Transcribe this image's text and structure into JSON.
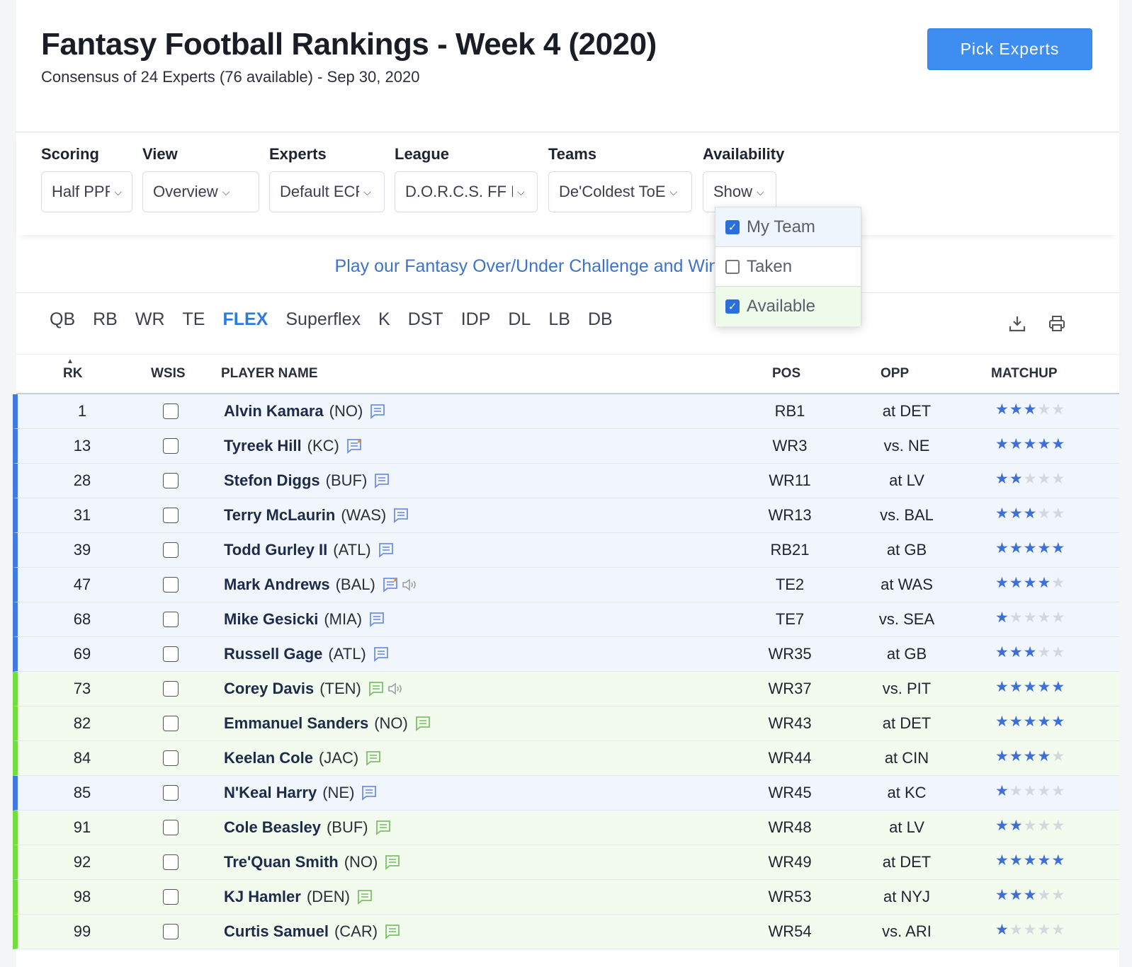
{
  "header": {
    "title": "Fantasy Football Rankings - Week 4 (2020)",
    "subtitle": "Consensus of 24 Experts (76 available) - Sep 30, 2020",
    "pick_experts_label": "Pick Experts"
  },
  "filters": {
    "scoring": {
      "label": "Scoring",
      "value": "Half PPR"
    },
    "view": {
      "label": "View",
      "value": "Overview"
    },
    "experts": {
      "label": "Experts",
      "value": "Default ECR"
    },
    "league": {
      "label": "League",
      "value": "D.O.R.C.S. FF League"
    },
    "teams": {
      "label": "Teams",
      "value": "De'Coldest ToE"
    },
    "availability": {
      "label": "Availability",
      "value": "Show"
    }
  },
  "availability_dropdown": {
    "items": [
      {
        "label": "My Team",
        "checked": true
      },
      {
        "label": "Taken",
        "checked": false
      },
      {
        "label": "Available",
        "checked": true
      }
    ]
  },
  "promo": "Play our Fantasy Over/Under Challenge and Win",
  "position_tabs": [
    "QB",
    "RB",
    "WR",
    "TE",
    "FLEX",
    "Superflex",
    "K",
    "DST",
    "IDP",
    "DL",
    "LB",
    "DB"
  ],
  "active_tab": "FLEX",
  "icons": {
    "download": "download-icon",
    "print": "print-icon",
    "note": "note-icon",
    "sound": "sound-icon"
  },
  "colors": {
    "my_team": "#3f7be0",
    "available": "#72dd3c",
    "accent": "#3d8ef0",
    "star": "#3e6fd8"
  },
  "table": {
    "headers": {
      "rk": "RK",
      "wsis": "WSIS",
      "player": "PLAYER NAME",
      "pos": "POS",
      "opp": "OPP",
      "matchup": "MATCHUP"
    },
    "rows": [
      {
        "rk": "1",
        "name": "Alvin Kamara",
        "team": "(NO)",
        "pos": "RB1",
        "opp": "at DET",
        "stars": 3,
        "status": "my_team",
        "note": "plain",
        "sound": false
      },
      {
        "rk": "13",
        "name": "Tyreek Hill",
        "team": "(KC)",
        "pos": "WR3",
        "opp": "vs. NE",
        "stars": 5,
        "status": "my_team",
        "note": "new",
        "sound": false
      },
      {
        "rk": "28",
        "name": "Stefon Diggs",
        "team": "(BUF)",
        "pos": "WR11",
        "opp": "at LV",
        "stars": 2,
        "status": "my_team",
        "note": "plain",
        "sound": false
      },
      {
        "rk": "31",
        "name": "Terry McLaurin",
        "team": "(WAS)",
        "pos": "WR13",
        "opp": "vs. BAL",
        "stars": 3,
        "status": "my_team",
        "note": "plain",
        "sound": false
      },
      {
        "rk": "39",
        "name": "Todd Gurley II",
        "team": "(ATL)",
        "pos": "RB21",
        "opp": "at GB",
        "stars": 5,
        "status": "my_team",
        "note": "plain",
        "sound": false
      },
      {
        "rk": "47",
        "name": "Mark Andrews",
        "team": "(BAL)",
        "pos": "TE2",
        "opp": "at WAS",
        "stars": 4,
        "status": "my_team",
        "note": "new",
        "sound": true
      },
      {
        "rk": "68",
        "name": "Mike Gesicki",
        "team": "(MIA)",
        "pos": "TE7",
        "opp": "vs. SEA",
        "stars": 1,
        "status": "my_team",
        "note": "plain",
        "sound": false
      },
      {
        "rk": "69",
        "name": "Russell Gage",
        "team": "(ATL)",
        "pos": "WR35",
        "opp": "at GB",
        "stars": 3,
        "status": "my_team",
        "note": "plain",
        "sound": false
      },
      {
        "rk": "73",
        "name": "Corey Davis",
        "team": "(TEN)",
        "pos": "WR37",
        "opp": "vs. PIT",
        "stars": 5,
        "status": "available",
        "note": "plain",
        "sound": true
      },
      {
        "rk": "82",
        "name": "Emmanuel Sanders",
        "team": "(NO)",
        "pos": "WR43",
        "opp": "at DET",
        "stars": 5,
        "status": "available",
        "note": "plain",
        "sound": false
      },
      {
        "rk": "84",
        "name": "Keelan Cole",
        "team": "(JAC)",
        "pos": "WR44",
        "opp": "at CIN",
        "stars": 4,
        "status": "available",
        "note": "plain",
        "sound": false
      },
      {
        "rk": "85",
        "name": "N'Keal Harry",
        "team": "(NE)",
        "pos": "WR45",
        "opp": "at KC",
        "stars": 1,
        "status": "my_team",
        "note": "plain",
        "sound": false
      },
      {
        "rk": "91",
        "name": "Cole Beasley",
        "team": "(BUF)",
        "pos": "WR48",
        "opp": "at LV",
        "stars": 2,
        "status": "available",
        "note": "plain",
        "sound": false
      },
      {
        "rk": "92",
        "name": "Tre'Quan Smith",
        "team": "(NO)",
        "pos": "WR49",
        "opp": "at DET",
        "stars": 5,
        "status": "available",
        "note": "plain",
        "sound": false
      },
      {
        "rk": "98",
        "name": "KJ Hamler",
        "team": "(DEN)",
        "pos": "WR53",
        "opp": "at NYJ",
        "stars": 3,
        "status": "available",
        "note": "plain",
        "sound": false
      },
      {
        "rk": "99",
        "name": "Curtis Samuel",
        "team": "(CAR)",
        "pos": "WR54",
        "opp": "vs. ARI",
        "stars": 1,
        "status": "available",
        "note": "plain",
        "sound": false
      }
    ]
  }
}
